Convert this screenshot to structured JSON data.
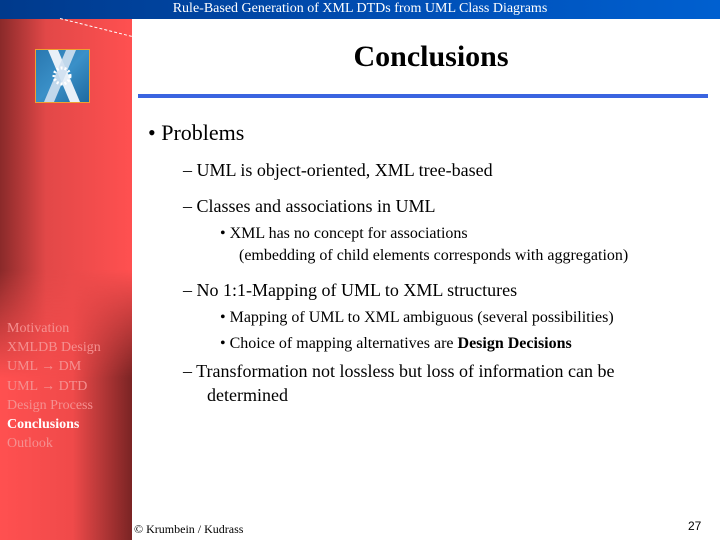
{
  "header": {
    "title": "Rule-Based Generation of XML DTDs from UML Class Diagrams"
  },
  "slide": {
    "title": "Conclusions",
    "bullets": [
      {
        "text": "• Problems"
      },
      {
        "text": "– UML is object-oriented, XML tree-based"
      },
      {
        "text": "– Classes and associations in UML"
      },
      {
        "text": "• XML has no concept for associations"
      },
      {
        "text": "(embedding of child elements corresponds with aggregation)"
      },
      {
        "text": "– No 1:1-Mapping of UML to XML structures"
      },
      {
        "text": "• Mapping of UML to XML ambiguous (several possibilities)"
      },
      {
        "text": "• Choice of mapping alternatives are ",
        "bold": "Design Decisions"
      },
      {
        "text": "– Transformation not lossless but loss of information can be"
      },
      {
        "text": "determined"
      }
    ]
  },
  "nav": {
    "items": [
      "Motivation",
      "XMLDB Design",
      "UML → DM",
      "UML → DTD",
      "Design Process",
      "Conclusions",
      "Outlook"
    ],
    "active": "Conclusions"
  },
  "footer": {
    "copyright": "© Krumbein / Kudrass",
    "page": "27"
  },
  "colors": {
    "topbar": "#0050b8",
    "sidebar": "#ff5050",
    "rule": "#3a64e0"
  }
}
